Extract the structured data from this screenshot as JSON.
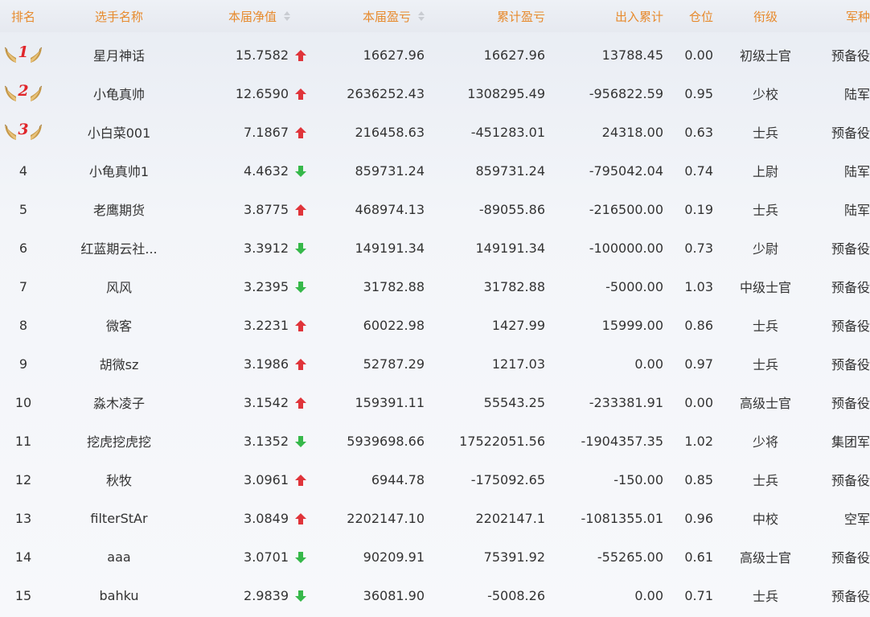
{
  "header": {
    "rank": "排名",
    "name": "选手名称",
    "net_value": "本届净值",
    "profit": "本届盈亏",
    "cumulative": "累计盈亏",
    "flow": "出入累计",
    "position": "仓位",
    "title": "衔级",
    "army": "军种"
  },
  "colors": {
    "header_text": "#e78a2d",
    "up": "#e0343a",
    "down": "#36b84a",
    "medal_number": "#e0262b"
  },
  "rows": [
    {
      "rank": "1",
      "medal": true,
      "name": "星月神话",
      "net": "15.7582",
      "trend": "up",
      "profit": "16627.96",
      "cum": "16627.96",
      "flow": "13788.45",
      "pos": "0.00",
      "title": "初级士官",
      "army": "预备役"
    },
    {
      "rank": "2",
      "medal": true,
      "name": "小龟真帅",
      "net": "12.6590",
      "trend": "up",
      "profit": "2636252.43",
      "cum": "1308295.49",
      "flow": "-956822.59",
      "pos": "0.95",
      "title": "少校",
      "army": "陆军"
    },
    {
      "rank": "3",
      "medal": true,
      "name": "小白菜001",
      "net": "7.1867",
      "trend": "up",
      "profit": "216458.63",
      "cum": "-451283.01",
      "flow": "24318.00",
      "pos": "0.63",
      "title": "士兵",
      "army": "预备役"
    },
    {
      "rank": "4",
      "medal": false,
      "name": "小龟真帅1",
      "net": "4.4632",
      "trend": "down",
      "profit": "859731.24",
      "cum": "859731.24",
      "flow": "-795042.04",
      "pos": "0.74",
      "title": "上尉",
      "army": "陆军"
    },
    {
      "rank": "5",
      "medal": false,
      "name": "老鹰期货",
      "net": "3.8775",
      "trend": "up",
      "profit": "468974.13",
      "cum": "-89055.86",
      "flow": "-216500.00",
      "pos": "0.19",
      "title": "士兵",
      "army": "陆军"
    },
    {
      "rank": "6",
      "medal": false,
      "name": "红蓝期云社...",
      "net": "3.3912",
      "trend": "down",
      "profit": "149191.34",
      "cum": "149191.34",
      "flow": "-100000.00",
      "pos": "0.73",
      "title": "少尉",
      "army": "预备役"
    },
    {
      "rank": "7",
      "medal": false,
      "name": "风风",
      "net": "3.2395",
      "trend": "down",
      "profit": "31782.88",
      "cum": "31782.88",
      "flow": "-5000.00",
      "pos": "1.03",
      "title": "中级士官",
      "army": "预备役"
    },
    {
      "rank": "8",
      "medal": false,
      "name": "微客",
      "net": "3.2231",
      "trend": "up",
      "profit": "60022.98",
      "cum": "1427.99",
      "flow": "15999.00",
      "pos": "0.86",
      "title": "士兵",
      "army": "预备役"
    },
    {
      "rank": "9",
      "medal": false,
      "name": "胡微sz",
      "net": "3.1986",
      "trend": "up",
      "profit": "52787.29",
      "cum": "1217.03",
      "flow": "0.00",
      "pos": "0.97",
      "title": "士兵",
      "army": "预备役"
    },
    {
      "rank": "10",
      "medal": false,
      "name": "淼木凌子",
      "net": "3.1542",
      "trend": "up",
      "profit": "159391.11",
      "cum": "55543.25",
      "flow": "-233381.91",
      "pos": "0.00",
      "title": "高级士官",
      "army": "预备役"
    },
    {
      "rank": "11",
      "medal": false,
      "name": "挖虎挖虎挖",
      "net": "3.1352",
      "trend": "down",
      "profit": "5939698.66",
      "cum": "17522051.56",
      "flow": "-1904357.35",
      "pos": "1.02",
      "title": "少将",
      "army": "集团军"
    },
    {
      "rank": "12",
      "medal": false,
      "name": "秋牧",
      "net": "3.0961",
      "trend": "up",
      "profit": "6944.78",
      "cum": "-175092.65",
      "flow": "-150.00",
      "pos": "0.85",
      "title": "士兵",
      "army": "预备役"
    },
    {
      "rank": "13",
      "medal": false,
      "name": "filterStAr",
      "net": "3.0849",
      "trend": "up",
      "profit": "2202147.10",
      "cum": "2202147.1",
      "flow": "-1081355.01",
      "pos": "0.96",
      "title": "中校",
      "army": "空军"
    },
    {
      "rank": "14",
      "medal": false,
      "name": "aaa",
      "net": "3.0701",
      "trend": "down",
      "profit": "90209.91",
      "cum": "75391.92",
      "flow": "-55265.00",
      "pos": "0.61",
      "title": "高级士官",
      "army": "预备役"
    },
    {
      "rank": "15",
      "medal": false,
      "name": "bahku",
      "net": "2.9839",
      "trend": "down",
      "profit": "36081.90",
      "cum": "-5008.26",
      "flow": "0.00",
      "pos": "0.71",
      "title": "士兵",
      "army": "预备役"
    }
  ]
}
